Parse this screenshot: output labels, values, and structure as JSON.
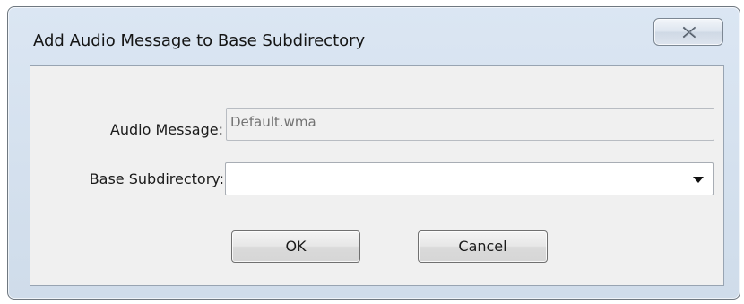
{
  "dialog": {
    "title": "Add Audio Message to Base Subdirectory",
    "close_icon": "close-x-icon"
  },
  "form": {
    "audio_message": {
      "label": "Audio Message:",
      "value": "Default.wma"
    },
    "base_subdirectory": {
      "label": "Base Subdirectory:",
      "value": "",
      "dropdown_icon": "chevron-down-icon"
    }
  },
  "buttons": {
    "ok_label": "OK",
    "cancel_label": "Cancel"
  }
}
